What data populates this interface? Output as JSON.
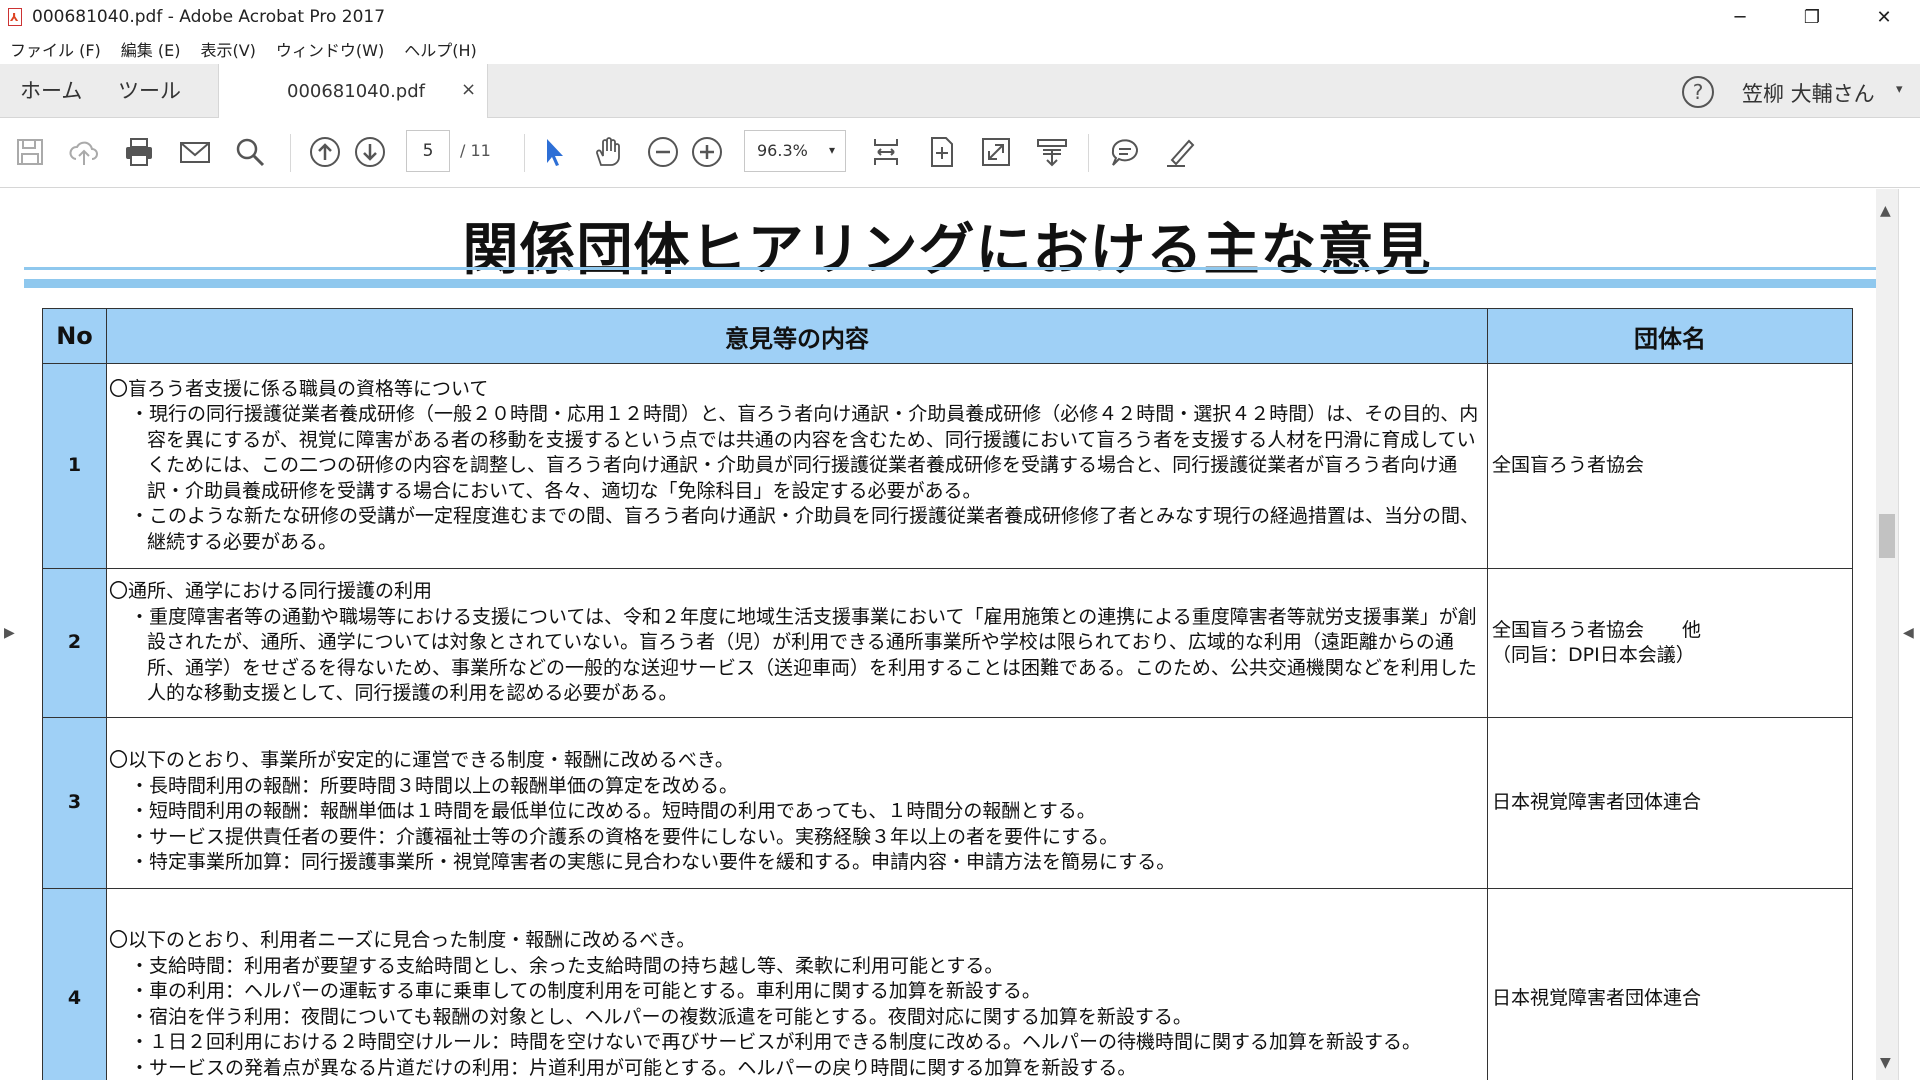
{
  "window": {
    "title": "000681040.pdf - Adobe Acrobat Pro 2017",
    "controls": [
      "─",
      "❐",
      "✕"
    ]
  },
  "menu": [
    "ファイル (F)",
    "編集 (E)",
    "表示(V)",
    "ウィンドウ(W)",
    "ヘルプ(H)"
  ],
  "tabs": {
    "home": "ホーム",
    "tools": "ツール",
    "document": "000681040.pdf",
    "close": "×",
    "help": "?",
    "user": "笠柳 大輔さん",
    "user_caret": "▾"
  },
  "toolbar": {
    "page_current": "5",
    "page_total": "/ 11",
    "zoom": "96.3%",
    "zoom_caret": "▾"
  },
  "colors": {
    "header_fill": "#9fd0f6",
    "rule": "#8fc8ee",
    "select_tool": "#2d6fd6"
  },
  "document": {
    "title": "関係団体ヒアリングにおける主な意見",
    "columns": {
      "no": "No",
      "content": "意見等の内容",
      "org": "団体名"
    },
    "rows": [
      {
        "no": "1",
        "heading": "〇盲ろう者支援に係る職員の資格等について",
        "bullets": [
          "・現行の同行援護従業者養成研修（一般２０時間・応用１２時間）と、盲ろう者向け通訳・介助員養成研修（必修４２時間・選択４２時間）は、その目的、内容を異にするが、視覚に障害がある者の移動を支援するという点では共通の内容を含むため、同行援護において盲ろう者を支援する人材を円滑に育成していくためには、この二つの研修の内容を調整し、盲ろう者向け通訳・介助員が同行援護従業者養成研修を受講する場合と、同行援護従業者が盲ろう者向け通訳・介助員養成研修を受講する場合において、各々、適切な「免除科目」を設定する必要がある。",
          "・このような新たな研修の受講が一定程度進むまでの間、盲ろう者向け通訳・介助員を同行援護従業者養成研修修了者とみなす現行の経過措置は、当分の間、継続する必要がある。"
        ],
        "org": [
          "全国盲ろう者協会"
        ]
      },
      {
        "no": "2",
        "heading": "〇通所、通学における同行援護の利用",
        "bullets": [
          "・重度障害者等の通勤や職場等における支援については、令和２年度に地域生活支援事業において「雇用施策との連携による重度障害者等就労支援事業」が創設されたが、通所、通学については対象とされていない。盲ろう者（児）が利用できる通所事業所や学校は限られており、広域的な利用（遠距離からの通所、通学）をせざるを得ないため、事業所などの一般的な送迎サービス（送迎車両）を利用することは困難である。このため、公共交通機関などを利用した人的な移動支援として、同行援護の利用を認める必要がある。"
        ],
        "org": [
          "全国盲ろう者協会　　他",
          "（同旨：DPI日本会議）"
        ]
      },
      {
        "no": "3",
        "heading": "〇以下のとおり、事業所が安定的に運営できる制度・報酬に改めるべき。",
        "bullets": [
          "・長時間利用の報酬：所要時間３時間以上の報酬単価の算定を改める。",
          "・短時間利用の報酬：報酬単価は１時間を最低単位に改める。短時間の利用であっても、１時間分の報酬とする。",
          "・サービス提供責任者の要件：介護福祉士等の介護系の資格を要件にしない。実務経験３年以上の者を要件にする。",
          "・特定事業所加算：同行援護事業所・視覚障害者の実態に見合わない要件を緩和する。申請内容・申請方法を簡易にする。"
        ],
        "org": [
          "日本視覚障害者団体連合"
        ]
      },
      {
        "no": "4",
        "heading": "〇以下のとおり、利用者ニーズに見合った制度・報酬に改めるべき。",
        "bullets": [
          "・支給時間：利用者が要望する支給時間とし、余った支給時間の持ち越し等、柔軟に利用可能とする。",
          "・車の利用：ヘルパーの運転する車に乗車しての制度利用を可能とする。車利用に関する加算を新設する。",
          "・宿泊を伴う利用：夜間についても報酬の対象とし、ヘルパーの複数派遣を可能とする。夜間対応に関する加算を新設する。",
          "・１日２回利用における２時間空けルール：時間を空けないで再びサービスが利用できる制度に改める。ヘルパーの待機時間に関する加算を新設する。",
          "・サービスの発着点が異なる片道だけの利用：片道利用が可能とする。ヘルパーの戻り時間に関する加算を新設する。"
        ],
        "org": [
          "日本視覚障害者団体連合"
        ]
      }
    ]
  }
}
